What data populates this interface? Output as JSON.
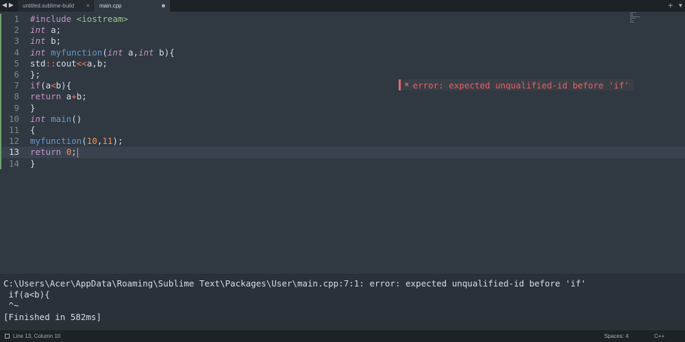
{
  "tabbar": {
    "back_icon": "triangle-left",
    "forward_icon": "triangle-right",
    "tabs": [
      {
        "label": "untitled.sublime-build",
        "close": "×"
      },
      {
        "label": "main.cpp"
      }
    ],
    "new_tab": "+",
    "tab_menu": "▾"
  },
  "editor": {
    "active_line": 13,
    "line_numbers": [
      "1",
      "2",
      "3",
      "4",
      "5",
      "6",
      "7",
      "8",
      "9",
      "10",
      "11",
      "12",
      "13",
      "14"
    ],
    "modified_lines": [
      1,
      2,
      3,
      4,
      5,
      6,
      7,
      8,
      9,
      10,
      11,
      12,
      13,
      14
    ],
    "code": [
      "#include <iostream>",
      "int a;",
      "int b;",
      "int myfunction(int a,int b){",
      "std::cout<<a,b;",
      "};",
      "if(a<b){",
      "return a+b;",
      "}",
      "int main()",
      "{",
      "myfunction(10,11);",
      "return 0;",
      "}"
    ]
  },
  "inline_error": {
    "icon": "×",
    "message": "error: expected unqualified-id before 'if'"
  },
  "output_panel": {
    "lines": [
      "C:\\Users\\Acer\\AppData\\Roaming\\Sublime Text\\Packages\\User\\main.cpp:7:1: error: expected unqualified-id before 'if'",
      " if(a<b){",
      " ^~",
      "[Finished in 582ms]"
    ]
  },
  "statusbar": {
    "position": "Line 13, Column 10",
    "indentation": "Spaces: 4",
    "syntax": "C++"
  },
  "colors": {
    "background": "#303841",
    "error": "#ec5f67",
    "keyword": "#c594c5",
    "function": "#6699cc",
    "number": "#f99157",
    "modified_marker": "#6ea26e"
  }
}
